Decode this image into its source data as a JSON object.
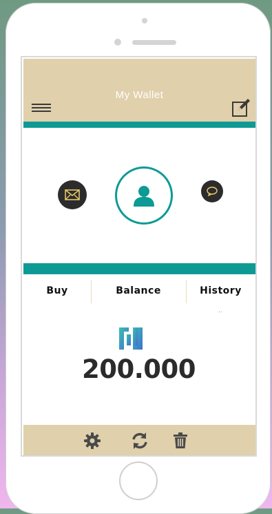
{
  "app": {
    "title": "My Wallet"
  },
  "tabs": [
    {
      "label": "Buy"
    },
    {
      "label": "Balance"
    },
    {
      "label": "History"
    }
  ],
  "tab_overflow": "..",
  "balance": {
    "amount": "200.000"
  },
  "icons": {
    "menu": "hamburger-menu-icon",
    "edit": "edit-icon",
    "mail": "mail-icon",
    "avatar": "user-icon",
    "chat": "chat-bubble-icon",
    "logo": "brand-logo-icon",
    "settings": "gear-icon",
    "refresh": "refresh-icon",
    "delete": "trash-icon"
  },
  "colors": {
    "header": "#e0d0ab",
    "accent_teal": "#0e9a94",
    "icon_dark": "#2c2c2c",
    "mail_icon": "#e8c86a",
    "chat_icon": "#e8c86a",
    "footer_icons": "#4a4a4a"
  }
}
